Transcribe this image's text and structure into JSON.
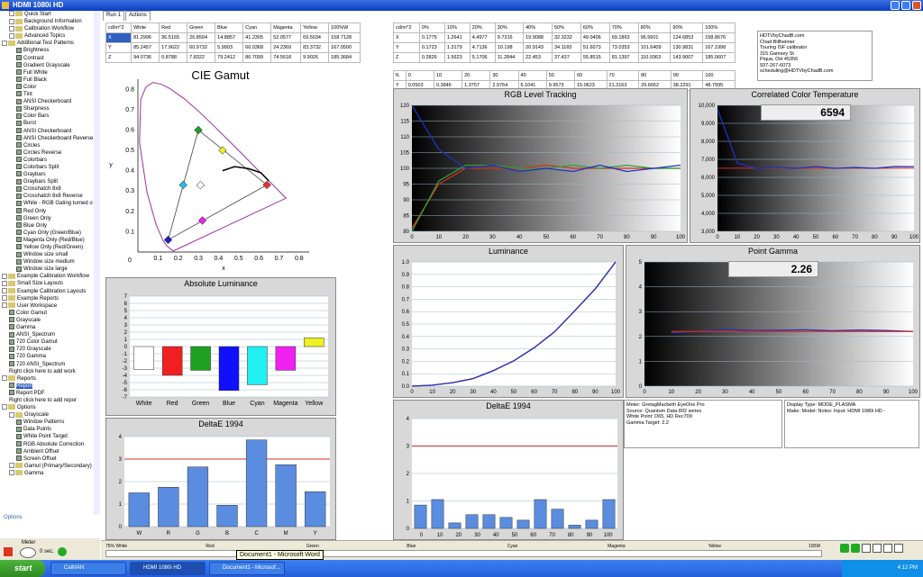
{
  "window": {
    "title": "HDMI 1080i HD"
  },
  "tree": {
    "items": [
      {
        "label": "Quick Start",
        "indent": 1,
        "kind": "folder"
      },
      {
        "label": "Background Information",
        "indent": 1,
        "kind": "folder"
      },
      {
        "label": "Calibration Workflow",
        "indent": 1,
        "kind": "folder"
      },
      {
        "label": "Advanced Topics",
        "indent": 1,
        "kind": "folder"
      },
      {
        "label": "Additional Test Patterns",
        "indent": 0,
        "kind": "folder"
      },
      {
        "label": "Brightness",
        "indent": 2,
        "kind": "page"
      },
      {
        "label": "Contrast",
        "indent": 2,
        "kind": "page"
      },
      {
        "label": "Gradient Grayscale",
        "indent": 2,
        "kind": "page"
      },
      {
        "label": "Full White",
        "indent": 2,
        "kind": "page"
      },
      {
        "label": "Full Black",
        "indent": 2,
        "kind": "page"
      },
      {
        "label": "Color",
        "indent": 2,
        "kind": "page"
      },
      {
        "label": "Tint",
        "indent": 2,
        "kind": "page"
      },
      {
        "label": "ANSI Checkerboard",
        "indent": 2,
        "kind": "page"
      },
      {
        "label": "Sharpness",
        "indent": 2,
        "kind": "page"
      },
      {
        "label": "Color Bars",
        "indent": 2,
        "kind": "page"
      },
      {
        "label": "Burst",
        "indent": 2,
        "kind": "page"
      },
      {
        "label": "ANSI Checkerboard",
        "indent": 2,
        "kind": "page"
      },
      {
        "label": "ANSI Checkerboard Reverse",
        "indent": 2,
        "kind": "page"
      },
      {
        "label": "Circles",
        "indent": 2,
        "kind": "page"
      },
      {
        "label": "Circles Reverse",
        "indent": 2,
        "kind": "page"
      },
      {
        "label": "Colorbars",
        "indent": 2,
        "kind": "page"
      },
      {
        "label": "Colorbars Split",
        "indent": 2,
        "kind": "page"
      },
      {
        "label": "Graybars",
        "indent": 2,
        "kind": "page"
      },
      {
        "label": "Graybars Split",
        "indent": 2,
        "kind": "page"
      },
      {
        "label": "Crosshatch 8x8",
        "indent": 2,
        "kind": "page"
      },
      {
        "label": "Crosshatch 8x8 Reverse",
        "indent": 2,
        "kind": "page"
      },
      {
        "label": "White - RGB Gating turned o",
        "indent": 2,
        "kind": "page"
      },
      {
        "label": "Red Only",
        "indent": 2,
        "kind": "page"
      },
      {
        "label": "Green Only",
        "indent": 2,
        "kind": "page"
      },
      {
        "label": "Blue Only",
        "indent": 2,
        "kind": "page"
      },
      {
        "label": "Cyan Only (Green/Blue)",
        "indent": 2,
        "kind": "page"
      },
      {
        "label": "Magenta Only (Red/Blue)",
        "indent": 2,
        "kind": "page"
      },
      {
        "label": "Yellow Only (Red/Green)",
        "indent": 2,
        "kind": "page"
      },
      {
        "label": "Window size small",
        "indent": 2,
        "kind": "page"
      },
      {
        "label": "Window size medium",
        "indent": 2,
        "kind": "page"
      },
      {
        "label": "Window size large",
        "indent": 2,
        "kind": "page"
      },
      {
        "label": "Example Calibration Workflow",
        "indent": 0,
        "kind": "folder"
      },
      {
        "label": "Small Size Layouts",
        "indent": 0,
        "kind": "folder"
      },
      {
        "label": "Example Calibration Layouts",
        "indent": 0,
        "kind": "folder"
      },
      {
        "label": "Example Reports",
        "indent": 0,
        "kind": "folder"
      },
      {
        "label": "User Workspace",
        "indent": 0,
        "kind": "folder"
      },
      {
        "label": "Color Gamut",
        "indent": 1,
        "kind": "page"
      },
      {
        "label": "Grayscale",
        "indent": 1,
        "kind": "page"
      },
      {
        "label": "Gamma",
        "indent": 1,
        "kind": "page"
      },
      {
        "label": "ANSI_Spectrum",
        "indent": 1,
        "kind": "page"
      },
      {
        "label": "720 Color Gamut",
        "indent": 1,
        "kind": "page"
      },
      {
        "label": "720 Grayscale",
        "indent": 1,
        "kind": "page"
      },
      {
        "label": "720 Gamma",
        "indent": 1,
        "kind": "page"
      },
      {
        "label": "720 ANSI_Spectrum",
        "indent": 1,
        "kind": "page"
      },
      {
        "label": "Right click here to add work",
        "indent": 1,
        "kind": "text"
      },
      {
        "label": "Reports",
        "indent": 0,
        "kind": "folder"
      },
      {
        "label": "Report",
        "indent": 1,
        "kind": "page",
        "selected": true
      },
      {
        "label": "Report PDF",
        "indent": 1,
        "kind": "page"
      },
      {
        "label": "Right click here to add repor",
        "indent": 1,
        "kind": "text"
      },
      {
        "label": "Options",
        "indent": 0,
        "kind": "folder"
      },
      {
        "label": "Grayscale",
        "indent": 1,
        "kind": "folder"
      },
      {
        "label": "Window Patterns",
        "indent": 2,
        "kind": "page"
      },
      {
        "label": "Data Points",
        "indent": 2,
        "kind": "page"
      },
      {
        "label": "White Point Target",
        "indent": 2,
        "kind": "page"
      },
      {
        "label": "RGB Absolute Correction",
        "indent": 2,
        "kind": "page"
      },
      {
        "label": "Ambient Offset",
        "indent": 2,
        "kind": "page"
      },
      {
        "label": "Screen Offset",
        "indent": 2,
        "kind": "page"
      },
      {
        "label": "Gamut (Primary/Secondary)",
        "indent": 1,
        "kind": "folder"
      },
      {
        "label": "Gamma",
        "indent": 1,
        "kind": "folder"
      }
    ],
    "options_label": "Options",
    "meter_label": "Meter",
    "meter_secs": "0 sec."
  },
  "tabs": [
    "Run 1",
    "Actions"
  ],
  "color_table": {
    "header": [
      "cd/m^2",
      "White",
      "Red",
      "Green",
      "Blue",
      "Cyan",
      "Magenta",
      "Yellow",
      "100%W"
    ],
    "rows": [
      [
        "X",
        "81.2996",
        "36.5165",
        "26.8594",
        "14.8857",
        "41.2305",
        "52.0577",
        "69.5034",
        "158.7128"
      ],
      [
        "Y",
        "85.2457",
        "17.9622",
        "60.9732",
        "5.9903",
        "66.0368",
        "24.2369",
        "83.3732",
        "167.0500"
      ],
      [
        "Z",
        "94.0736",
        "0.8788",
        "7.8322",
        "79.2412",
        "86.7099",
        "74.5618",
        "9.9026",
        "185.3684"
      ]
    ]
  },
  "gray_table": {
    "header": [
      "cd/m^2",
      "0%",
      "10%",
      "20%",
      "30%",
      "40%",
      "50%",
      "60%",
      "70%",
      "80%",
      "90%",
      "100%"
    ],
    "rows": [
      [
        "X",
        "0.1775",
        "1.2641",
        "4.4977",
        "9.7316",
        "19.9088",
        "32.3232",
        "49.0406",
        "69.1863",
        "96.5601",
        "124.6853",
        "158.8676"
      ],
      [
        "Y",
        "0.1723",
        "1.3179",
        "4.7136",
        "10.198",
        "20.9143",
        "34.1165",
        "51.6073",
        "73.0353",
        "101.6409",
        "130.9831",
        "167.1998"
      ],
      [
        "Z",
        "0.2826",
        "1.5623",
        "5.1706",
        "11.2844",
        "22.453",
        "37.437",
        "55.8515",
        "81.1397",
        "110.9363",
        "143.9007",
        "185.0607"
      ]
    ]
  },
  "fl_table": {
    "header": [
      "fL",
      "0",
      "10",
      "20",
      "30",
      "40",
      "50",
      "60",
      "70",
      "80",
      "90",
      "100"
    ],
    "row": [
      "Y",
      "0.0503",
      "0.3846",
      "1.3757",
      "2.9764",
      "6.1041",
      "9.9573",
      "15.0623",
      "21.3163",
      "29.6652",
      "38.2291",
      "48.7995"
    ]
  },
  "contact": [
    "HDTVbyChadB.com",
    "Chad Billheimer",
    "Touring ISF calibrator",
    "315 Gamsey St",
    "Piqua, OH 45356",
    "937-267-6073",
    "scheduling@HDTVbyChadB.com"
  ],
  "meter_info": [
    "Meter: GretagMacbeth EyeOne Pro",
    "Source: Quantum Data 802 series",
    "White Point: D65, HD Rec709",
    "Gamma Target: 2.2"
  ],
  "display_info": [
    "Display Type: MODE_PLASMA",
    "Make: Model: Notes: Input: HDMI 1080i HD    -"
  ],
  "panels": {
    "cie_title": "CIE Gamut",
    "rgb_title": "RGB Level Tracking",
    "cct_title": "Correlated Color Temperature",
    "cct_value": "6594",
    "lum_title": "Luminance",
    "gamma_title": "Point Gamma",
    "gamma_value": "2.26",
    "abs_title": "Absolute Luminance",
    "de1_title": "DeltaE 1994",
    "de2_title": "DeltaE 1994"
  },
  "chart_data": [
    {
      "type": "scatter",
      "title": "CIE Gamut",
      "xlabel": "x",
      "ylabel": "y",
      "xlim": [
        0,
        0.85
      ],
      "ylim": [
        0,
        0.85
      ],
      "series": [
        {
          "values": [
            [
              0.64,
              0.33
            ],
            [
              0.3,
              0.6
            ],
            [
              0.15,
              0.06
            ]
          ]
        },
        {
          "values": [
            [
              0.31,
              0.329
            ]
          ]
        }
      ]
    },
    {
      "type": "line",
      "title": "RGB Level Tracking",
      "x": [
        0,
        10,
        20,
        30,
        40,
        50,
        60,
        70,
        80,
        90,
        100
      ],
      "ylim": [
        80,
        120
      ],
      "series": [
        {
          "color": "#d03020",
          "values": [
            81,
            95,
            100,
            100,
            100,
            101,
            100,
            100,
            100,
            100,
            100
          ]
        },
        {
          "color": "#30a030",
          "values": [
            80,
            96,
            101,
            101,
            100,
            100,
            101,
            100,
            101,
            100,
            100
          ]
        },
        {
          "color": "#2030c0",
          "values": [
            120,
            106,
            100,
            101,
            99,
            100,
            99,
            101,
            99,
            100,
            101
          ]
        }
      ]
    },
    {
      "type": "line",
      "title": "Correlated Color Temperature",
      "x": [
        0,
        10,
        20,
        30,
        40,
        50,
        60,
        70,
        80,
        90,
        100
      ],
      "ylim": [
        3000,
        10000
      ],
      "series": [
        {
          "color": "#2030c0",
          "values": [
            9800,
            6800,
            6500,
            6550,
            6500,
            6600,
            6500,
            6550,
            6500,
            6600,
            6594
          ]
        }
      ],
      "target": 6504
    },
    {
      "type": "line",
      "title": "Luminance",
      "x": [
        0,
        10,
        20,
        30,
        40,
        50,
        60,
        70,
        80,
        90,
        100
      ],
      "ylim": [
        0,
        1
      ],
      "series": [
        {
          "color": "#d03020",
          "values": [
            0,
            0.008,
            0.028,
            0.061,
            0.125,
            0.204,
            0.309,
            0.437,
            0.608,
            0.783,
            1.0
          ]
        },
        {
          "color": "#2030c0",
          "values": [
            0,
            0.008,
            0.028,
            0.061,
            0.125,
            0.204,
            0.309,
            0.437,
            0.608,
            0.783,
            1.0
          ]
        }
      ]
    },
    {
      "type": "line",
      "title": "Point Gamma",
      "x": [
        10,
        20,
        30,
        40,
        50,
        60,
        70,
        80,
        90,
        100
      ],
      "ylim": [
        0,
        5
      ],
      "series": [
        {
          "color": "#2030c0",
          "values": [
            2.15,
            2.2,
            2.28,
            2.24,
            2.25,
            2.27,
            2.23,
            2.26,
            2.24,
            2.2
          ]
        },
        {
          "color": "#d03020",
          "values": [
            2.2,
            2.2,
            2.2,
            2.2,
            2.2,
            2.2,
            2.2,
            2.2,
            2.2,
            2.2
          ]
        }
      ]
    },
    {
      "type": "bar",
      "title": "Absolute Luminance",
      "categories": [
        "White",
        "Red",
        "Green",
        "Blue",
        "Cyan",
        "Magenta",
        "Yellow"
      ],
      "values": [
        -3.2,
        -4.0,
        -3.3,
        -6.1,
        -5.3,
        -3.3,
        1.2
      ],
      "colors": [
        "#ffffff",
        "#f02020",
        "#20a020",
        "#1010ff",
        "#20f0f0",
        "#f020f0",
        "#f0f020"
      ],
      "ylim": [
        -7,
        7
      ]
    },
    {
      "type": "bar",
      "title": "DeltaE 1994",
      "categories": [
        "W",
        "R",
        "G",
        "B",
        "C",
        "M",
        "Y"
      ],
      "values": [
        1.5,
        1.75,
        2.65,
        0.95,
        3.85,
        2.75,
        1.55
      ],
      "ylim": [
        0,
        4
      ],
      "target": 3
    },
    {
      "type": "bar",
      "title": "DeltaE 1994",
      "categories": [
        "0",
        "",
        "10",
        "",
        "20",
        "",
        "30",
        "",
        "40",
        "",
        "50",
        "",
        "60",
        "",
        "70",
        "",
        "80",
        "",
        "90",
        "",
        "100"
      ],
      "values": [
        0.85,
        1.05,
        0.2,
        0.5,
        0.5,
        0.4,
        0.3,
        1.05,
        0.7,
        0.12,
        0.3,
        1.05
      ],
      "ylim": [
        0,
        4
      ],
      "target": 3,
      "ticks": [
        "0",
        "10",
        "20",
        "30",
        "40",
        "50",
        "60",
        "70",
        "80",
        "90",
        "100"
      ]
    }
  ],
  "bottom": {
    "labels": [
      "75% White",
      "Red",
      "Green",
      "Blue",
      "Cyan",
      "Magenta",
      "Yellow",
      "100W"
    ]
  },
  "tooltip": "Document1 - Microsoft Word",
  "taskbar": {
    "start": "start",
    "tasks": [
      "CalMAN",
      "HDMI 1080i HD",
      "Document1 - Microsof..."
    ],
    "clock": "4:12 PM"
  }
}
